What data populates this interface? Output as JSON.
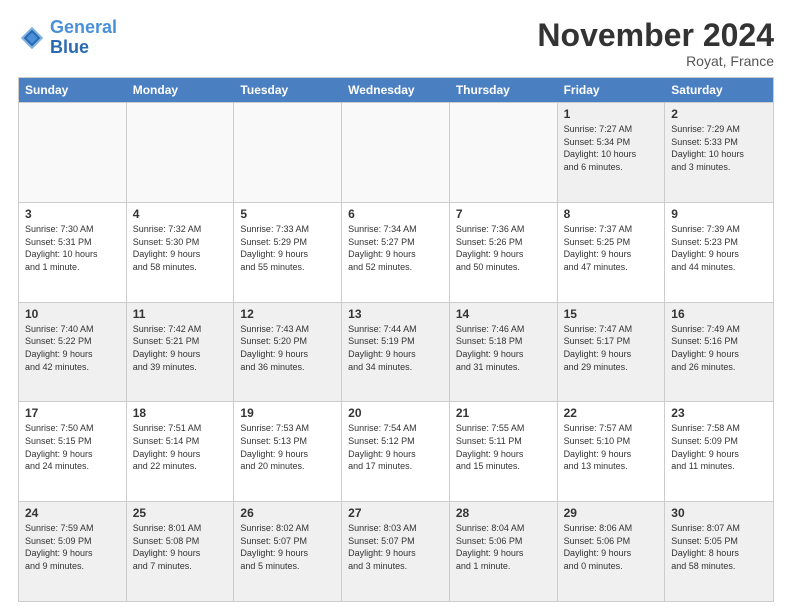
{
  "logo": {
    "line1": "General",
    "line2": "Blue"
  },
  "title": "November 2024",
  "location": "Royat, France",
  "header": {
    "days": [
      "Sunday",
      "Monday",
      "Tuesday",
      "Wednesday",
      "Thursday",
      "Friday",
      "Saturday"
    ]
  },
  "weeks": [
    {
      "cells": [
        {
          "day": "",
          "empty": true
        },
        {
          "day": "",
          "empty": true
        },
        {
          "day": "",
          "empty": true
        },
        {
          "day": "",
          "empty": true
        },
        {
          "day": "",
          "empty": true
        },
        {
          "day": "1",
          "text": "Sunrise: 7:27 AM\nSunset: 5:34 PM\nDaylight: 10 hours\nand 6 minutes."
        },
        {
          "day": "2",
          "text": "Sunrise: 7:29 AM\nSunset: 5:33 PM\nDaylight: 10 hours\nand 3 minutes."
        }
      ]
    },
    {
      "cells": [
        {
          "day": "3",
          "text": "Sunrise: 7:30 AM\nSunset: 5:31 PM\nDaylight: 10 hours\nand 1 minute."
        },
        {
          "day": "4",
          "text": "Sunrise: 7:32 AM\nSunset: 5:30 PM\nDaylight: 9 hours\nand 58 minutes."
        },
        {
          "day": "5",
          "text": "Sunrise: 7:33 AM\nSunset: 5:29 PM\nDaylight: 9 hours\nand 55 minutes."
        },
        {
          "day": "6",
          "text": "Sunrise: 7:34 AM\nSunset: 5:27 PM\nDaylight: 9 hours\nand 52 minutes."
        },
        {
          "day": "7",
          "text": "Sunrise: 7:36 AM\nSunset: 5:26 PM\nDaylight: 9 hours\nand 50 minutes."
        },
        {
          "day": "8",
          "text": "Sunrise: 7:37 AM\nSunset: 5:25 PM\nDaylight: 9 hours\nand 47 minutes."
        },
        {
          "day": "9",
          "text": "Sunrise: 7:39 AM\nSunset: 5:23 PM\nDaylight: 9 hours\nand 44 minutes."
        }
      ]
    },
    {
      "cells": [
        {
          "day": "10",
          "text": "Sunrise: 7:40 AM\nSunset: 5:22 PM\nDaylight: 9 hours\nand 42 minutes."
        },
        {
          "day": "11",
          "text": "Sunrise: 7:42 AM\nSunset: 5:21 PM\nDaylight: 9 hours\nand 39 minutes."
        },
        {
          "day": "12",
          "text": "Sunrise: 7:43 AM\nSunset: 5:20 PM\nDaylight: 9 hours\nand 36 minutes."
        },
        {
          "day": "13",
          "text": "Sunrise: 7:44 AM\nSunset: 5:19 PM\nDaylight: 9 hours\nand 34 minutes."
        },
        {
          "day": "14",
          "text": "Sunrise: 7:46 AM\nSunset: 5:18 PM\nDaylight: 9 hours\nand 31 minutes."
        },
        {
          "day": "15",
          "text": "Sunrise: 7:47 AM\nSunset: 5:17 PM\nDaylight: 9 hours\nand 29 minutes."
        },
        {
          "day": "16",
          "text": "Sunrise: 7:49 AM\nSunset: 5:16 PM\nDaylight: 9 hours\nand 26 minutes."
        }
      ]
    },
    {
      "cells": [
        {
          "day": "17",
          "text": "Sunrise: 7:50 AM\nSunset: 5:15 PM\nDaylight: 9 hours\nand 24 minutes."
        },
        {
          "day": "18",
          "text": "Sunrise: 7:51 AM\nSunset: 5:14 PM\nDaylight: 9 hours\nand 22 minutes."
        },
        {
          "day": "19",
          "text": "Sunrise: 7:53 AM\nSunset: 5:13 PM\nDaylight: 9 hours\nand 20 minutes."
        },
        {
          "day": "20",
          "text": "Sunrise: 7:54 AM\nSunset: 5:12 PM\nDaylight: 9 hours\nand 17 minutes."
        },
        {
          "day": "21",
          "text": "Sunrise: 7:55 AM\nSunset: 5:11 PM\nDaylight: 9 hours\nand 15 minutes."
        },
        {
          "day": "22",
          "text": "Sunrise: 7:57 AM\nSunset: 5:10 PM\nDaylight: 9 hours\nand 13 minutes."
        },
        {
          "day": "23",
          "text": "Sunrise: 7:58 AM\nSunset: 5:09 PM\nDaylight: 9 hours\nand 11 minutes."
        }
      ]
    },
    {
      "cells": [
        {
          "day": "24",
          "text": "Sunrise: 7:59 AM\nSunset: 5:09 PM\nDaylight: 9 hours\nand 9 minutes."
        },
        {
          "day": "25",
          "text": "Sunrise: 8:01 AM\nSunset: 5:08 PM\nDaylight: 9 hours\nand 7 minutes."
        },
        {
          "day": "26",
          "text": "Sunrise: 8:02 AM\nSunset: 5:07 PM\nDaylight: 9 hours\nand 5 minutes."
        },
        {
          "day": "27",
          "text": "Sunrise: 8:03 AM\nSunset: 5:07 PM\nDaylight: 9 hours\nand 3 minutes."
        },
        {
          "day": "28",
          "text": "Sunrise: 8:04 AM\nSunset: 5:06 PM\nDaylight: 9 hours\nand 1 minute."
        },
        {
          "day": "29",
          "text": "Sunrise: 8:06 AM\nSunset: 5:06 PM\nDaylight: 9 hours\nand 0 minutes."
        },
        {
          "day": "30",
          "text": "Sunrise: 8:07 AM\nSunset: 5:05 PM\nDaylight: 8 hours\nand 58 minutes."
        }
      ]
    }
  ]
}
